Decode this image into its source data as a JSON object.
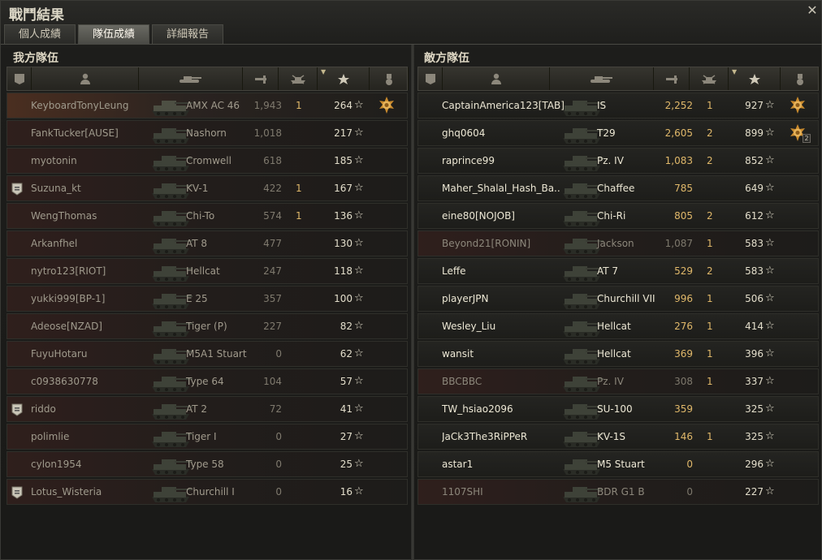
{
  "window": {
    "title": "戰鬥結果",
    "close_icon": "close-icon"
  },
  "tabs": [
    {
      "label": "個人成績",
      "active": false
    },
    {
      "label": "隊伍成績",
      "active": true
    },
    {
      "label": "詳細報告",
      "active": false
    }
  ],
  "ally": {
    "title": "我方隊伍",
    "columns": [
      "platoon-icon",
      "player-icon",
      "tank-icon",
      "damage-icon",
      "kills-icon",
      "xp-star-icon",
      "medal-icon"
    ],
    "rows": [
      {
        "name": "KeyboardTonyLeung",
        "tank": "AMX AC 46",
        "damage": "1,943",
        "kills": "1",
        "xp": "264",
        "self": true,
        "dead": false,
        "platoon": false,
        "medal": true,
        "medal_count": ""
      },
      {
        "name": "FankTucker[AUSE]",
        "tank": "Nashorn",
        "damage": "1,018",
        "kills": "",
        "xp": "217",
        "self": false,
        "dead": true,
        "platoon": false,
        "medal": false,
        "medal_count": ""
      },
      {
        "name": "myotonin",
        "tank": "Cromwell",
        "damage": "618",
        "kills": "",
        "xp": "185",
        "self": false,
        "dead": true,
        "platoon": false,
        "medal": false,
        "medal_count": ""
      },
      {
        "name": "Suzuna_kt",
        "tank": "KV-1",
        "damage": "422",
        "kills": "1",
        "xp": "167",
        "self": false,
        "dead": true,
        "platoon": true,
        "medal": false,
        "medal_count": ""
      },
      {
        "name": "WengThomas",
        "tank": "Chi-To",
        "damage": "574",
        "kills": "1",
        "xp": "136",
        "self": false,
        "dead": true,
        "platoon": false,
        "medal": false,
        "medal_count": ""
      },
      {
        "name": "Arkanfhel",
        "tank": "AT 8",
        "damage": "477",
        "kills": "",
        "xp": "130",
        "self": false,
        "dead": true,
        "platoon": false,
        "medal": false,
        "medal_count": ""
      },
      {
        "name": "nytro123[RIOT]",
        "tank": "Hellcat",
        "damage": "247",
        "kills": "",
        "xp": "118",
        "self": false,
        "dead": true,
        "platoon": false,
        "medal": false,
        "medal_count": ""
      },
      {
        "name": "yukki999[BP-1]",
        "tank": "E 25",
        "damage": "357",
        "kills": "",
        "xp": "100",
        "self": false,
        "dead": true,
        "platoon": false,
        "medal": false,
        "medal_count": ""
      },
      {
        "name": "Adeose[NZAD]",
        "tank": "Tiger (P)",
        "damage": "227",
        "kills": "",
        "xp": "82",
        "self": false,
        "dead": true,
        "platoon": false,
        "medal": false,
        "medal_count": ""
      },
      {
        "name": "FuyuHotaru",
        "tank": "M5A1 Stuart",
        "damage": "0",
        "kills": "",
        "xp": "62",
        "self": false,
        "dead": true,
        "platoon": false,
        "medal": false,
        "medal_count": ""
      },
      {
        "name": "c0938630778",
        "tank": "Type 64",
        "damage": "104",
        "kills": "",
        "xp": "57",
        "self": false,
        "dead": true,
        "platoon": false,
        "medal": false,
        "medal_count": ""
      },
      {
        "name": "riddo",
        "tank": "AT 2",
        "damage": "72",
        "kills": "",
        "xp": "41",
        "self": false,
        "dead": true,
        "platoon": true,
        "medal": false,
        "medal_count": ""
      },
      {
        "name": "polimlie",
        "tank": "Tiger I",
        "damage": "0",
        "kills": "",
        "xp": "27",
        "self": false,
        "dead": true,
        "platoon": false,
        "medal": false,
        "medal_count": ""
      },
      {
        "name": "cylon1954",
        "tank": "Type 58",
        "damage": "0",
        "kills": "",
        "xp": "25",
        "self": false,
        "dead": true,
        "platoon": false,
        "medal": false,
        "medal_count": ""
      },
      {
        "name": "Lotus_Wisteria",
        "tank": "Churchill I",
        "damage": "0",
        "kills": "",
        "xp": "16",
        "self": false,
        "dead": true,
        "platoon": true,
        "medal": false,
        "medal_count": ""
      }
    ]
  },
  "enemy": {
    "title": "敵方隊伍",
    "columns": [
      "platoon-icon",
      "player-icon",
      "tank-icon",
      "damage-icon",
      "kills-icon",
      "xp-star-icon",
      "medal-icon"
    ],
    "rows": [
      {
        "name": "CaptainAmerica123[TAB]",
        "tank": "IS",
        "damage": "2,252",
        "kills": "1",
        "xp": "927",
        "self": false,
        "dead": false,
        "platoon": false,
        "medal": true,
        "medal_count": ""
      },
      {
        "name": "ghq0604",
        "tank": "T29",
        "damage": "2,605",
        "kills": "2",
        "xp": "899",
        "self": false,
        "dead": false,
        "platoon": false,
        "medal": true,
        "medal_count": "2"
      },
      {
        "name": "raprince99",
        "tank": "Pz. IV",
        "damage": "1,083",
        "kills": "2",
        "xp": "852",
        "self": false,
        "dead": false,
        "platoon": false,
        "medal": false,
        "medal_count": ""
      },
      {
        "name": "Maher_Shalal_Hash_Ba..",
        "tank": "Chaffee",
        "damage": "785",
        "kills": "",
        "xp": "649",
        "self": false,
        "dead": false,
        "platoon": false,
        "medal": false,
        "medal_count": ""
      },
      {
        "name": "eine80[NOJOB]",
        "tank": "Chi-Ri",
        "damage": "805",
        "kills": "2",
        "xp": "612",
        "self": false,
        "dead": false,
        "platoon": false,
        "medal": false,
        "medal_count": ""
      },
      {
        "name": "Beyond21[RONIN]",
        "tank": "Jackson",
        "damage": "1,087",
        "kills": "1",
        "xp": "583",
        "self": false,
        "dead": true,
        "platoon": false,
        "medal": false,
        "medal_count": ""
      },
      {
        "name": "Leffe",
        "tank": "AT 7",
        "damage": "529",
        "kills": "2",
        "xp": "583",
        "self": false,
        "dead": false,
        "platoon": false,
        "medal": false,
        "medal_count": ""
      },
      {
        "name": "playerJPN",
        "tank": "Churchill VII",
        "damage": "996",
        "kills": "1",
        "xp": "506",
        "self": false,
        "dead": false,
        "platoon": false,
        "medal": false,
        "medal_count": ""
      },
      {
        "name": "Wesley_Liu",
        "tank": "Hellcat",
        "damage": "276",
        "kills": "1",
        "xp": "414",
        "self": false,
        "dead": false,
        "platoon": false,
        "medal": false,
        "medal_count": ""
      },
      {
        "name": "wansit",
        "tank": "Hellcat",
        "damage": "369",
        "kills": "1",
        "xp": "396",
        "self": false,
        "dead": false,
        "platoon": false,
        "medal": false,
        "medal_count": ""
      },
      {
        "name": "BBCBBC",
        "tank": "Pz. IV",
        "damage": "308",
        "kills": "1",
        "xp": "337",
        "self": false,
        "dead": true,
        "platoon": false,
        "medal": false,
        "medal_count": ""
      },
      {
        "name": "TW_hsiao2096",
        "tank": "SU-100",
        "damage": "359",
        "kills": "",
        "xp": "325",
        "self": false,
        "dead": false,
        "platoon": false,
        "medal": false,
        "medal_count": ""
      },
      {
        "name": "JaCk3The3RiPPeR",
        "tank": "KV-1S",
        "damage": "146",
        "kills": "1",
        "xp": "325",
        "self": false,
        "dead": false,
        "platoon": false,
        "medal": false,
        "medal_count": ""
      },
      {
        "name": "astar1",
        "tank": "M5 Stuart",
        "damage": "0",
        "kills": "",
        "xp": "296",
        "self": false,
        "dead": false,
        "platoon": false,
        "medal": false,
        "medal_count": ""
      },
      {
        "name": "1107SHI",
        "tank": "BDR G1 B",
        "damage": "0",
        "kills": "",
        "xp": "227",
        "self": false,
        "dead": true,
        "platoon": false,
        "medal": false,
        "medal_count": ""
      }
    ]
  },
  "star_glyph": "☆",
  "colors": {
    "accent_gold": "#e0b86a",
    "text_light": "#ece7d4",
    "text_dim": "#9f9a8c",
    "self_row": "#4a2e20",
    "dead_row": "#2f1f1c"
  }
}
